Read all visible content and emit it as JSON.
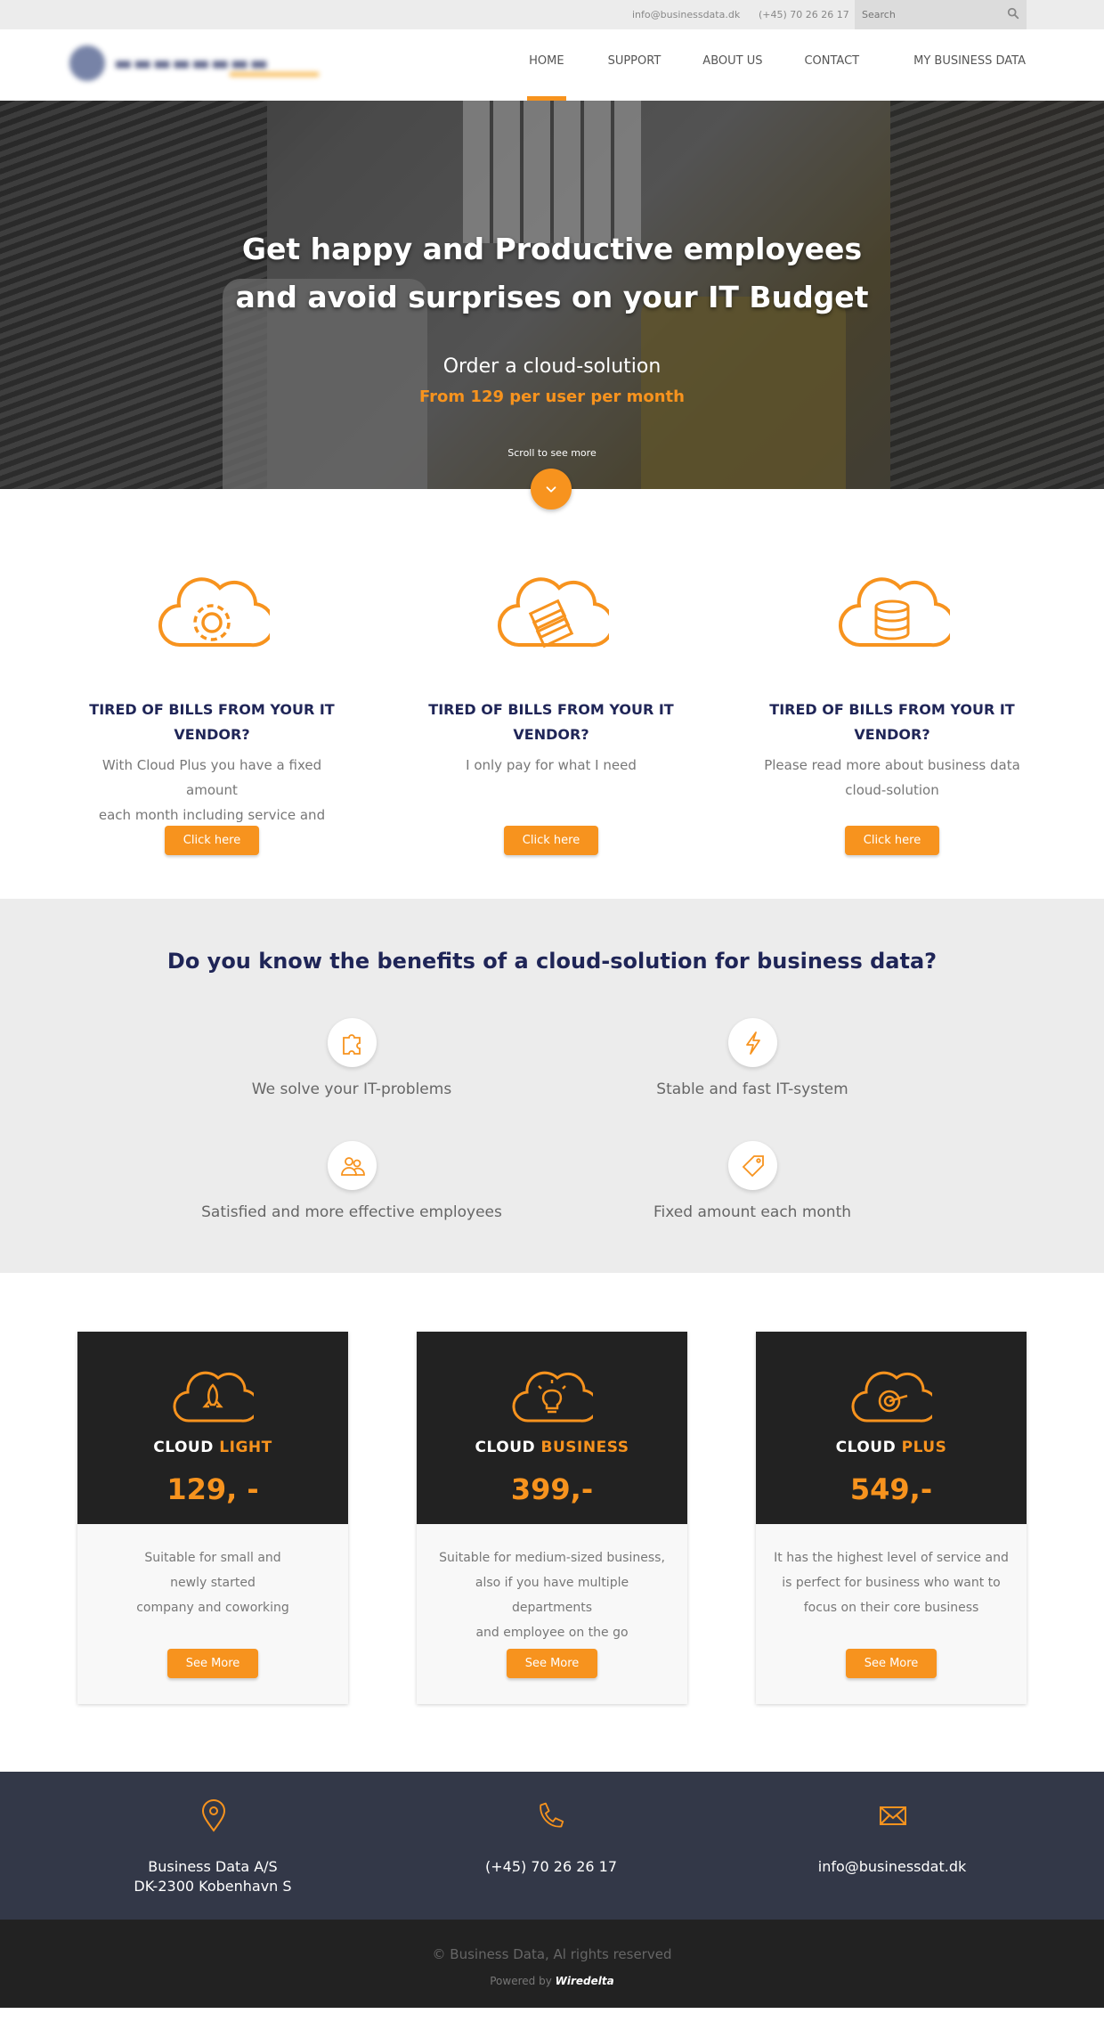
{
  "topbar": {
    "email": "info@businessdata.dk",
    "phone": "(+45) 70 26 26 17",
    "search_placeholder": "Search"
  },
  "nav": {
    "items": [
      "HOME",
      "SUPPORT",
      "ABOUT US",
      "CONTACT",
      "MY BUSINESS DATA"
    ],
    "active": "HOME"
  },
  "hero": {
    "title_line1": "Get happy and Productive employees",
    "title_line2": "and avoid surprises on your IT Budget",
    "order": "Order a cloud-solution",
    "price": "From 129 per user per month",
    "scroll": "Scroll to see more"
  },
  "features": [
    {
      "title_line1": "TIRED OF BILLS FROM YOUR IT",
      "title_line2": "VENDOR?",
      "text_line1": "With Cloud Plus you have a fixed amount",
      "text_line2": "each month including service and support",
      "button": "Click here",
      "icon": "cloud-gear-icon"
    },
    {
      "title_line1": "TIRED OF BILLS FROM YOUR IT",
      "title_line2": "VENDOR?",
      "text_line1": "I only pay for what I need",
      "text_line2": "",
      "button": "Click here",
      "icon": "cloud-money-icon"
    },
    {
      "title_line1": "TIRED OF BILLS FROM YOUR IT",
      "title_line2": "VENDOR?",
      "text_line1": "Please read more about business data",
      "text_line2": "cloud-solution",
      "button": "Click here",
      "icon": "cloud-database-icon"
    }
  ],
  "benefits": {
    "title": "Do you know the benefits of a cloud-solution for business data?",
    "items": [
      {
        "label": "We solve your IT-problems",
        "icon": "puzzle-icon"
      },
      {
        "label": "Stable and fast IT-system",
        "icon": "lightning-icon"
      },
      {
        "label": "Satisfied and more effective employees",
        "icon": "users-icon"
      },
      {
        "label": "Fixed amount each month",
        "icon": "price-tag-icon"
      }
    ]
  },
  "plans": [
    {
      "name_white": "CLOUD",
      "name_orange": "LIGHT",
      "amount": "129, -",
      "desc_line1": "Suitable for small and",
      "desc_line2": "newly started",
      "desc_line3": "company and coworking",
      "button": "See More",
      "icon": "cloud-rocket-icon"
    },
    {
      "name_white": "CLOUD",
      "name_orange": "BUSINESS",
      "amount": "399,-",
      "desc_line1": "Suitable for medium-sized business,",
      "desc_line2": "also if you have multiple departments",
      "desc_line3": "and employee on the go",
      "button": "See More",
      "icon": "cloud-bulb-icon"
    },
    {
      "name_white": "CLOUD",
      "name_orange": "PLUS",
      "amount": "549,-",
      "desc_line1": "It has the highest level of service and",
      "desc_line2": "is perfect for business who want to",
      "desc_line3": "focus on their core business",
      "button": "See More",
      "icon": "cloud-target-icon"
    }
  ],
  "contact": {
    "address_line1": "Business Data A/S",
    "address_line2": "DK-2300 Kobenhavn S",
    "phone": "(+45) 70 26 26 17",
    "email": "info@businessdat.dk"
  },
  "footer": {
    "copyright": "© Business Data, Al rights reserved",
    "powered_prefix": "Powered by",
    "powered_brand": "Wiredelta"
  },
  "colors": {
    "accent": "#f7931e",
    "navy": "#1f2557",
    "dark": "#222222",
    "footer_contact": "#333848"
  }
}
